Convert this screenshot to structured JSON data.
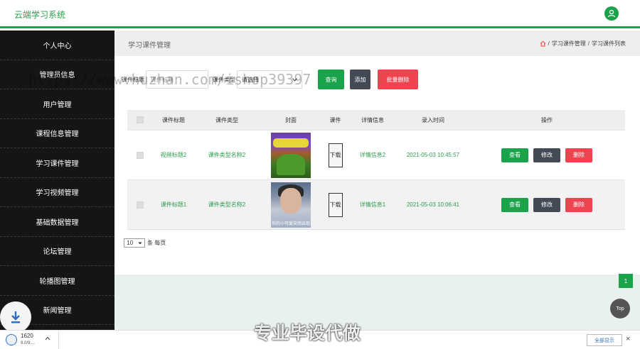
{
  "app": {
    "title": "云端学习系统"
  },
  "sidebar": {
    "items": [
      {
        "label": "个人中心"
      },
      {
        "label": "管理员信息"
      },
      {
        "label": "用户管理"
      },
      {
        "label": "课程信息管理"
      },
      {
        "label": "学习课件管理"
      },
      {
        "label": "学习视频管理"
      },
      {
        "label": "基础数据管理"
      },
      {
        "label": "论坛管理"
      },
      {
        "label": "轮播图管理"
      },
      {
        "label": "新闻管理"
      }
    ]
  },
  "page": {
    "title": "学习课件管理",
    "breadcrumb": [
      "学习课件管理",
      "学习课件列表"
    ],
    "breadcrumb_sep": "/"
  },
  "search": {
    "title_label": "课件标题",
    "title_placeholder": "课件标题",
    "type_label": "课件类型",
    "type_value": "请选择",
    "search_button": "查询",
    "add_button": "添加",
    "batch_delete_button": "批量删除"
  },
  "table": {
    "headers": [
      "课件标题",
      "课件类型",
      "封面",
      "课件",
      "详情信息",
      "录入时间",
      "操作"
    ],
    "rows": [
      {
        "title": "视频标题2",
        "type": "课件类型名称2",
        "file": "下载",
        "detail": "详情信息2",
        "time": "2021-05-03 10:45:57"
      },
      {
        "title": "课件标题1",
        "type": "课件类型名称2",
        "file": "下载",
        "detail": "详情信息1",
        "time": "2021-05-03 10:06:41",
        "cover_caption": "你的小可爱突然出现"
      }
    ],
    "op_view": "查看",
    "op_edit": "修改",
    "op_delete": "删除"
  },
  "pager": {
    "page_size": "10",
    "per_page_label": "条 每页",
    "current_page": "1"
  },
  "overlay": {
    "top_button": "Top",
    "watermark": "https://www.huzhan.com/ishop39397",
    "promo": "专业毕设代做"
  },
  "download_bar": {
    "file_name": "1620",
    "file_size": "9.0/9....",
    "show_all": "全部显示",
    "close": "×"
  },
  "colors": {
    "accent": "#1aa34a",
    "danger": "#ef4350",
    "dark": "#444a55",
    "sidebar": "#151515"
  }
}
